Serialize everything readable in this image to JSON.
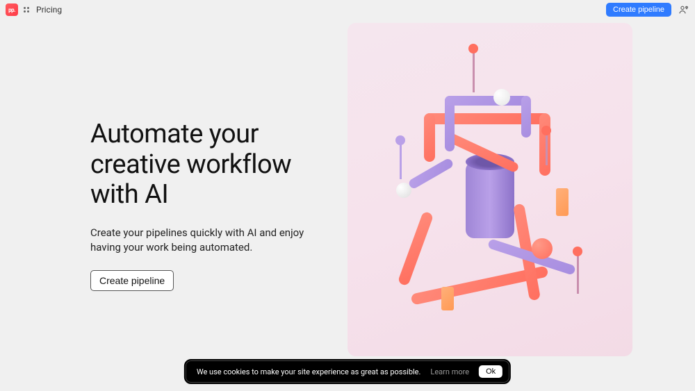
{
  "header": {
    "logo_text": "pp.",
    "pricing_label": "Pricing",
    "create_pipeline_label": "Create pipeline"
  },
  "hero": {
    "title": "Automate your creative workflow with AI",
    "subtitle": "Create your pipelines quickly with AI and enjoy having your work being automated.",
    "cta_label": "Create pipeline"
  },
  "cookie": {
    "message": "We use cookies to make your site experience as great as possible.",
    "learn_more": "Learn more",
    "ok": "Ok"
  },
  "colors": {
    "primary_button": "#2f7bff",
    "logo_bg": "#ff3b47",
    "pipe_orange": "#ff6f5f",
    "pipe_purple": "#a78de0",
    "canvas_bg": "#f5e6ee"
  }
}
